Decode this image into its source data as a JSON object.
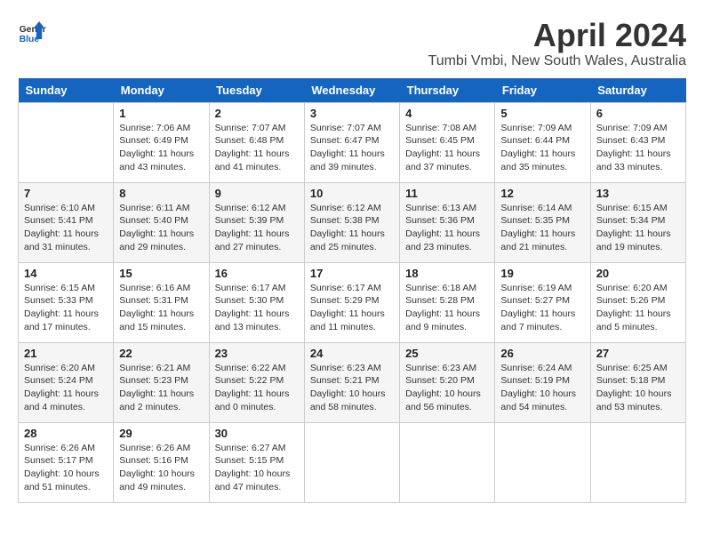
{
  "header": {
    "logo_text_general": "General",
    "logo_text_blue": "Blue",
    "month_title": "April 2024",
    "location": "Tumbi Vmbi, New South Wales, Australia"
  },
  "calendar": {
    "days_of_week": [
      "Sunday",
      "Monday",
      "Tuesday",
      "Wednesday",
      "Thursday",
      "Friday",
      "Saturday"
    ],
    "weeks": [
      [
        {
          "day": "",
          "sunrise": "",
          "sunset": "",
          "daylight": ""
        },
        {
          "day": "1",
          "sunrise": "Sunrise: 7:06 AM",
          "sunset": "Sunset: 6:49 PM",
          "daylight": "Daylight: 11 hours and 43 minutes."
        },
        {
          "day": "2",
          "sunrise": "Sunrise: 7:07 AM",
          "sunset": "Sunset: 6:48 PM",
          "daylight": "Daylight: 11 hours and 41 minutes."
        },
        {
          "day": "3",
          "sunrise": "Sunrise: 7:07 AM",
          "sunset": "Sunset: 6:47 PM",
          "daylight": "Daylight: 11 hours and 39 minutes."
        },
        {
          "day": "4",
          "sunrise": "Sunrise: 7:08 AM",
          "sunset": "Sunset: 6:45 PM",
          "daylight": "Daylight: 11 hours and 37 minutes."
        },
        {
          "day": "5",
          "sunrise": "Sunrise: 7:09 AM",
          "sunset": "Sunset: 6:44 PM",
          "daylight": "Daylight: 11 hours and 35 minutes."
        },
        {
          "day": "6",
          "sunrise": "Sunrise: 7:09 AM",
          "sunset": "Sunset: 6:43 PM",
          "daylight": "Daylight: 11 hours and 33 minutes."
        }
      ],
      [
        {
          "day": "7",
          "sunrise": "Sunrise: 6:10 AM",
          "sunset": "Sunset: 5:41 PM",
          "daylight": "Daylight: 11 hours and 31 minutes."
        },
        {
          "day": "8",
          "sunrise": "Sunrise: 6:11 AM",
          "sunset": "Sunset: 5:40 PM",
          "daylight": "Daylight: 11 hours and 29 minutes."
        },
        {
          "day": "9",
          "sunrise": "Sunrise: 6:12 AM",
          "sunset": "Sunset: 5:39 PM",
          "daylight": "Daylight: 11 hours and 27 minutes."
        },
        {
          "day": "10",
          "sunrise": "Sunrise: 6:12 AM",
          "sunset": "Sunset: 5:38 PM",
          "daylight": "Daylight: 11 hours and 25 minutes."
        },
        {
          "day": "11",
          "sunrise": "Sunrise: 6:13 AM",
          "sunset": "Sunset: 5:36 PM",
          "daylight": "Daylight: 11 hours and 23 minutes."
        },
        {
          "day": "12",
          "sunrise": "Sunrise: 6:14 AM",
          "sunset": "Sunset: 5:35 PM",
          "daylight": "Daylight: 11 hours and 21 minutes."
        },
        {
          "day": "13",
          "sunrise": "Sunrise: 6:15 AM",
          "sunset": "Sunset: 5:34 PM",
          "daylight": "Daylight: 11 hours and 19 minutes."
        }
      ],
      [
        {
          "day": "14",
          "sunrise": "Sunrise: 6:15 AM",
          "sunset": "Sunset: 5:33 PM",
          "daylight": "Daylight: 11 hours and 17 minutes."
        },
        {
          "day": "15",
          "sunrise": "Sunrise: 6:16 AM",
          "sunset": "Sunset: 5:31 PM",
          "daylight": "Daylight: 11 hours and 15 minutes."
        },
        {
          "day": "16",
          "sunrise": "Sunrise: 6:17 AM",
          "sunset": "Sunset: 5:30 PM",
          "daylight": "Daylight: 11 hours and 13 minutes."
        },
        {
          "day": "17",
          "sunrise": "Sunrise: 6:17 AM",
          "sunset": "Sunset: 5:29 PM",
          "daylight": "Daylight: 11 hours and 11 minutes."
        },
        {
          "day": "18",
          "sunrise": "Sunrise: 6:18 AM",
          "sunset": "Sunset: 5:28 PM",
          "daylight": "Daylight: 11 hours and 9 minutes."
        },
        {
          "day": "19",
          "sunrise": "Sunrise: 6:19 AM",
          "sunset": "Sunset: 5:27 PM",
          "daylight": "Daylight: 11 hours and 7 minutes."
        },
        {
          "day": "20",
          "sunrise": "Sunrise: 6:20 AM",
          "sunset": "Sunset: 5:26 PM",
          "daylight": "Daylight: 11 hours and 5 minutes."
        }
      ],
      [
        {
          "day": "21",
          "sunrise": "Sunrise: 6:20 AM",
          "sunset": "Sunset: 5:24 PM",
          "daylight": "Daylight: 11 hours and 4 minutes."
        },
        {
          "day": "22",
          "sunrise": "Sunrise: 6:21 AM",
          "sunset": "Sunset: 5:23 PM",
          "daylight": "Daylight: 11 hours and 2 minutes."
        },
        {
          "day": "23",
          "sunrise": "Sunrise: 6:22 AM",
          "sunset": "Sunset: 5:22 PM",
          "daylight": "Daylight: 11 hours and 0 minutes."
        },
        {
          "day": "24",
          "sunrise": "Sunrise: 6:23 AM",
          "sunset": "Sunset: 5:21 PM",
          "daylight": "Daylight: 10 hours and 58 minutes."
        },
        {
          "day": "25",
          "sunrise": "Sunrise: 6:23 AM",
          "sunset": "Sunset: 5:20 PM",
          "daylight": "Daylight: 10 hours and 56 minutes."
        },
        {
          "day": "26",
          "sunrise": "Sunrise: 6:24 AM",
          "sunset": "Sunset: 5:19 PM",
          "daylight": "Daylight: 10 hours and 54 minutes."
        },
        {
          "day": "27",
          "sunrise": "Sunrise: 6:25 AM",
          "sunset": "Sunset: 5:18 PM",
          "daylight": "Daylight: 10 hours and 53 minutes."
        }
      ],
      [
        {
          "day": "28",
          "sunrise": "Sunrise: 6:26 AM",
          "sunset": "Sunset: 5:17 PM",
          "daylight": "Daylight: 10 hours and 51 minutes."
        },
        {
          "day": "29",
          "sunrise": "Sunrise: 6:26 AM",
          "sunset": "Sunset: 5:16 PM",
          "daylight": "Daylight: 10 hours and 49 minutes."
        },
        {
          "day": "30",
          "sunrise": "Sunrise: 6:27 AM",
          "sunset": "Sunset: 5:15 PM",
          "daylight": "Daylight: 10 hours and 47 minutes."
        },
        {
          "day": "",
          "sunrise": "",
          "sunset": "",
          "daylight": ""
        },
        {
          "day": "",
          "sunrise": "",
          "sunset": "",
          "daylight": ""
        },
        {
          "day": "",
          "sunrise": "",
          "sunset": "",
          "daylight": ""
        },
        {
          "day": "",
          "sunrise": "",
          "sunset": "",
          "daylight": ""
        }
      ]
    ]
  }
}
